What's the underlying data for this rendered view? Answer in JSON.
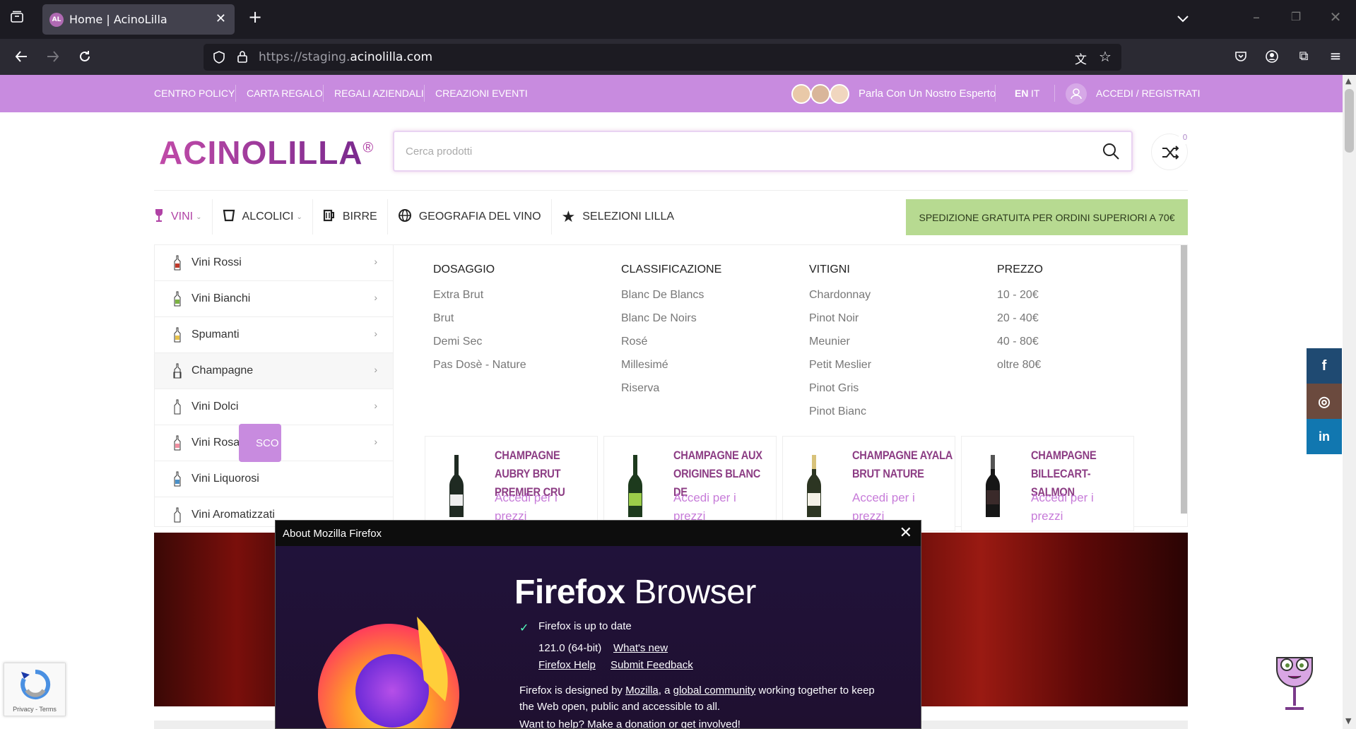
{
  "browser": {
    "tab_title": "Home | AcinoLilla",
    "tab_favicon": "AL",
    "url_prefix": "https://staging.",
    "url_domain": "acinolilla.com"
  },
  "topbar": {
    "links": [
      "CENTRO POLICY",
      "CARTA REGALO",
      "REGALI AZIENDALI",
      "CREAZIONI EVENTI"
    ],
    "expert": "Parla Con Un Nostro Esperto",
    "lang_en": "EN",
    "lang_it": "IT",
    "account": "ACCEDI / REGISTRATI"
  },
  "header": {
    "logo": "ACINOLILLA",
    "logo_mark": "®",
    "search_placeholder": "Cerca prodotti",
    "compare_count": "0"
  },
  "nav": {
    "items": [
      "VINI",
      "ALCOLICI",
      "BIRRE",
      "GEOGRAFIA DEL VINO",
      "SELEZIONI LILLA"
    ],
    "shipping": "SPEDIZIONE GRATUITA PER ORDINI SUPERIORI A 70€"
  },
  "sidebar": {
    "items": [
      "Vini Rossi",
      "Vini Bianchi",
      "Spumanti",
      "Champagne",
      "Vini Dolci",
      "Vini Rosati",
      "Vini Liquorosi",
      "Vini Aromatizzati"
    ]
  },
  "mega": {
    "columns": [
      {
        "title": "DOSAGGIO",
        "links": [
          "Extra Brut",
          "Brut",
          "Demi Sec",
          "Pas Dosè - Nature"
        ]
      },
      {
        "title": "CLASSIFICAZIONE",
        "links": [
          "Blanc De Blancs",
          "Blanc De Noirs",
          "Rosé",
          "Millesimé",
          "Riserva"
        ]
      },
      {
        "title": "VITIGNI",
        "links": [
          "Chardonnay",
          "Pinot Noir",
          "Meunier",
          "Petit Meslier",
          "Pinot Gris",
          "Pinot Bianc"
        ]
      },
      {
        "title": "PREZZO",
        "links": [
          "10 - 20€",
          "20 - 40€",
          "40 - 80€",
          "oltre 80€"
        ]
      }
    ],
    "products": [
      {
        "name": "CHAMPAGNE AUBRY BRUT PREMIER CRU",
        "price": "Accedi per i prezzi"
      },
      {
        "name": "CHAMPAGNE AUX ORIGINES BLANC DE",
        "price": "Accedi per i prezzi"
      },
      {
        "name": "CHAMPAGNE AYALA BRUT NATURE",
        "price": "Accedi per i prezzi"
      },
      {
        "name": "CHAMPAGNE BILLECART-SALMON",
        "price": "Accedi per i prezzi"
      }
    ]
  },
  "hero": {
    "button": "SCO"
  },
  "social": {
    "facebook": "f",
    "instagram": "◎",
    "linkedin": "in"
  },
  "recaptcha": {
    "text": "Privacy - Terms"
  },
  "about_dialog": {
    "title": "About Mozilla Firefox",
    "brand_bold": "Firefox",
    "brand_light": " Browser",
    "status": "Firefox is up to date",
    "version": "121.0 (64-bit)",
    "whats_new": "What's new",
    "help": "Firefox Help",
    "feedback": "Submit Feedback",
    "designed_pre": "Firefox is designed by ",
    "mozilla": "Mozilla",
    "designed_mid": ", a ",
    "community": "global community",
    "designed_post": " working together to keep",
    "designed_line2": "the Web open, public and accessible to all.",
    "help_line": "Want to help? Make a donation or get involved!"
  },
  "colors": {
    "brand_purple": "#c88bdf",
    "logo_purple": "#b042a5",
    "shipping_green": "#b7da91",
    "product_title": "#8c3d84"
  }
}
